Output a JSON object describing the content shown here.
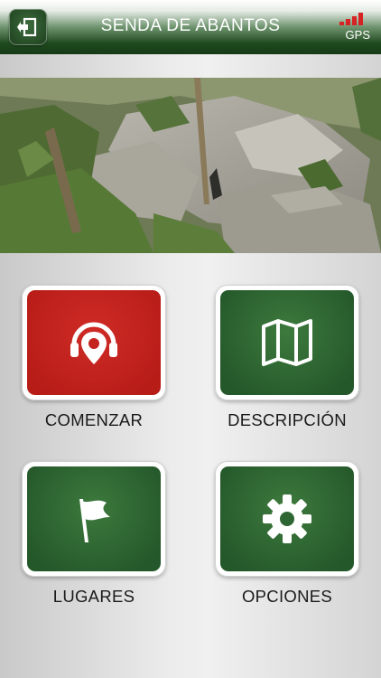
{
  "header": {
    "title": "SENDA DE ABANTOS",
    "exit_icon": "exit-icon",
    "gps_label": "GPS",
    "gps_signal_color": "#d62323"
  },
  "menu": {
    "items": [
      {
        "label": "COMENZAR",
        "icon": "headphones-pin-icon",
        "color": "#c4231e"
      },
      {
        "label": "DESCRIPCIÓN",
        "icon": "map-icon",
        "color": "#2e6633"
      },
      {
        "label": "LUGARES",
        "icon": "flag-icon",
        "color": "#2e6633"
      },
      {
        "label": "OPCIONES",
        "icon": "gear-icon",
        "color": "#2e6633"
      }
    ]
  }
}
